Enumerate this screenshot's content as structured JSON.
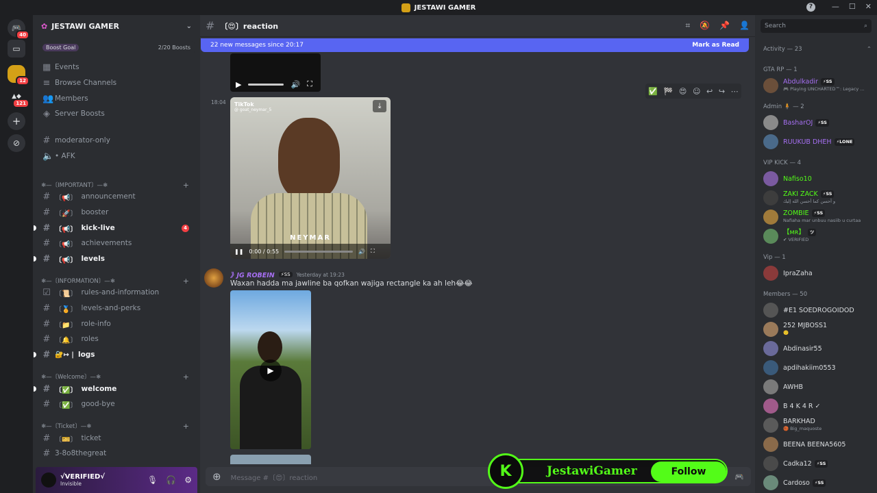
{
  "titlebar": {
    "title": "JESTAWI GAMER"
  },
  "servers": {
    "dm_badge": "40",
    "srv1_badge": "12",
    "srv2_badge": "121"
  },
  "guild": {
    "name": "JESTAWI GAMER",
    "boost_label": "Boost Goal",
    "boost_count": "2/20 Boosts"
  },
  "nav": [
    {
      "label": "Events",
      "icon": "calendar-icon"
    },
    {
      "label": "Browse Channels",
      "icon": "list-icon"
    },
    {
      "label": "Members",
      "icon": "members-icon"
    },
    {
      "label": "Server Boosts",
      "icon": "boost-icon"
    }
  ],
  "channels": {
    "moderator": "moderator-only",
    "afk": "• AFK",
    "cat_important": "❄—〔IMPORTANT〕—❄",
    "announcement": "announcement",
    "booster": "booster",
    "kick_live": "kick-live",
    "kick_live_badge": "4",
    "achievements": "achievements",
    "levels": "levels",
    "cat_information": "❄—〔INFORMATION〕—❄",
    "rules": "rules-and-information",
    "levels_perks": "levels-and-perks",
    "role_info": "role-info",
    "roles": "roles",
    "logs": "logs",
    "cat_welcome": "❄—〔Welcome〕—❄",
    "welcome": "welcome",
    "goodbye": "good-bye",
    "cat_ticket": "❄—〔Ticket〕—❄",
    "ticket": "ticket",
    "ticket2": "3-8o8thegreat"
  },
  "user": {
    "name": "√VERIFIED√",
    "status": "Invisible"
  },
  "header": {
    "channel": "〔😍〕reaction"
  },
  "banner": {
    "text": "22 new messages since 20:17",
    "action": "Mark as Read"
  },
  "messages": {
    "time1": "18:04",
    "video2": {
      "tiktok": "TikTok",
      "handle": "@ goat_neymar_5",
      "caption": "NEYMAR",
      "time": "0:00 / 0:55"
    },
    "msg2": {
      "user": "》JG ROBEIN",
      "badge": "⚡SS",
      "time": "Yesterday at 19:23",
      "text": "Waxan hadda ma jawline ba qofkan wajiga rectangle ka ah leh😂😂"
    }
  },
  "composer": {
    "placeholder": "Message #〔😍〕reaction"
  },
  "overlay": {
    "name": "JestawiGamer",
    "button": "Follow"
  },
  "members": {
    "search": "Search",
    "activity": "Activity — 23",
    "groups": [
      {
        "title": "GTA RP — 1",
        "members": [
          {
            "name": "Abdulkadir",
            "badge": "⚡SS",
            "sub": "🎮 Playing UNCHARTED™: Legacy ...",
            "color": "#a66ff2"
          }
        ]
      },
      {
        "title": "Admin 🧍 — 2",
        "members": [
          {
            "name": "BasharOJ",
            "badge": "⚡SS",
            "sub": "",
            "color": "#a66ff2"
          },
          {
            "name": "RUUKUB DHEH",
            "badge": "⚡LONE",
            "sub": "",
            "color": "#a66ff2"
          }
        ]
      },
      {
        "title": "VIP KICK — 4",
        "members": [
          {
            "name": "Nafiso10",
            "badge": "",
            "sub": "",
            "color": "#53fc18"
          },
          {
            "name": "ZAKI ZACK",
            "badge": "⚡SS",
            "sub": "و أحسن كما أحسن الله إليك",
            "color": "#53fc18"
          },
          {
            "name": "ZOMBIE",
            "badge": "⚡SS",
            "sub": "Nafiaha mar unbuu nasiib u curtaa",
            "color": "#53fc18"
          },
          {
            "name": "【ᴍʀ】",
            "badge": "ツ",
            "sub": "✔ VERIFIED",
            "color": "#53fc18"
          }
        ]
      },
      {
        "title": "Vip — 1",
        "members": [
          {
            "name": "IpraZaha",
            "badge": "",
            "sub": "",
            "color": "#dbdee1"
          }
        ]
      },
      {
        "title": "Members — 50",
        "members": [
          {
            "name": "#E1 SOEDROGOIDOD",
            "badge": "",
            "sub": "",
            "color": "#dbdee1"
          },
          {
            "name": "252 MJBOSS1",
            "badge": "",
            "sub": "🙂",
            "color": "#dbdee1"
          },
          {
            "name": "Abdinasir55",
            "badge": "",
            "sub": "",
            "color": "#dbdee1"
          },
          {
            "name": "apdihakiim0553",
            "badge": "",
            "sub": "",
            "color": "#dbdee1"
          },
          {
            "name": "AWHB",
            "badge": "",
            "sub": "",
            "color": "#dbdee1"
          },
          {
            "name": "B 4 K 4 R ✓",
            "badge": "",
            "sub": "",
            "color": "#dbdee1"
          },
          {
            "name": "BARKHAD",
            "badge": "",
            "sub": "🏀 Big_maquoste",
            "color": "#dbdee1"
          },
          {
            "name": "BEENA BEENA5605",
            "badge": "",
            "sub": "",
            "color": "#dbdee1"
          },
          {
            "name": "Cadka12",
            "badge": "⚡SS",
            "sub": "",
            "color": "#dbdee1"
          },
          {
            "name": "Cardoso",
            "badge": "⚡SS",
            "sub": "",
            "color": "#dbdee1"
          }
        ]
      }
    ]
  }
}
